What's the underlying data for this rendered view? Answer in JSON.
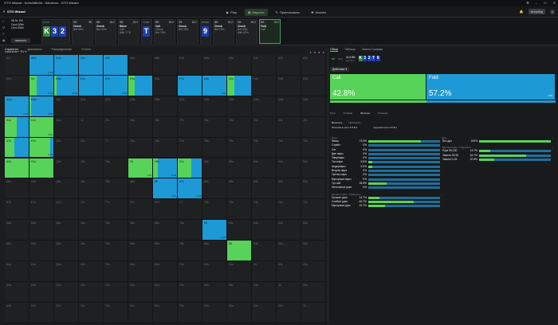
{
  "window": {
    "title": "GTO Wizard - Kc3s2d6h9d - Solutions - GTO Wizard",
    "controls": [
      "⚙",
      "–",
      "☐",
      "✕"
    ]
  },
  "app": {
    "brand": "GTO Wizard",
    "nav": [
      {
        "icon": "▶",
        "label": "Play",
        "active": false
      },
      {
        "icon": "▦",
        "label": "Изучить",
        "active": true
      },
      {
        "icon": "✎",
        "label": "Практиковать",
        "active": false
      },
      {
        "icon": "✚",
        "label": "Анализ",
        "active": false
      }
    ],
    "upgrade_label": "Апгрейд",
    "notifications_icon": "bell-icon",
    "avatar_letter": "U"
  },
  "settings": {
    "lines": [
      "5B 6c 100",
      "Cash 50bb",
      "Сеть 50bb"
    ],
    "button_label": "изменить"
  },
  "positions": [
    {
      "pos": "SB",
      "stack": "99",
      "action": "Check",
      "sub": "Bet 33%",
      "sel": false
    },
    {
      "pos": "BB",
      "stack": "16.2",
      "action": "Check",
      "sub": "Bet 30%",
      "sel": false
    },
    {
      "pos": "SB",
      "stack": "15.2",
      "action": "Raise",
      "sub": "Call",
      "extra": "Allin 77.8",
      "sel": false
    },
    {
      "pos": "BB",
      "stack": "15.2",
      "action": "Call",
      "sub": "Check",
      "extra": "Bet 75%",
      "sel": false
    },
    {
      "pos": "SB",
      "stack": "15.2",
      "action": "Check",
      "sub": "Bet 33%",
      "sel": false
    },
    {
      "pos": "BB",
      "stack": "15.2",
      "action": "Check",
      "sub": "Bet 75%",
      "sel": false
    },
    {
      "pos": "SB",
      "stack": "15.2",
      "action": "Check",
      "sub": "Bet 33%",
      "extra": "Allin 52%",
      "sel": false
    },
    {
      "pos": "BB",
      "stack": "15.2",
      "action": "Fold",
      "sub": "Call",
      "sel": true
    }
  ],
  "boards": [
    {
      "label": "FLOP",
      "stack": "3",
      "cards": [
        {
          "r": "K",
          "c": "g"
        },
        {
          "r": "3",
          "c": "b"
        },
        {
          "r": "2",
          "c": "b"
        }
      ]
    },
    {
      "label": "TURN",
      "stack": "",
      "cards": [
        {
          "r": "T",
          "c": "b"
        }
      ]
    },
    {
      "label": "RIVER",
      "stack": "",
      "cards": [
        {
          "r": "9",
          "c": "b"
        }
      ]
    }
  ],
  "grid_tabs": [
    {
      "label": "Стратегия",
      "active": true
    },
    {
      "label": "Диапазоны",
      "active": false
    },
    {
      "label": "Распределение",
      "active": false
    },
    {
      "label": "Отчеты",
      "active": false
    }
  ],
  "grid_dropdown": "стратегия + EV",
  "grid": {
    "ranks": [
      "A",
      "K",
      "Q",
      "J",
      "T",
      "9",
      "8",
      "7",
      "6",
      "5",
      "4",
      "3",
      "2"
    ],
    "strategies": {
      "AKs": [
        0.0,
        1.0,
        "-0.04"
      ],
      "AQs": [
        0.0,
        1.0,
        ""
      ],
      "AJs": [
        0.0,
        1.0,
        ""
      ],
      "ATs": [
        0.0,
        1.0,
        ""
      ],
      "KK": [
        0.3,
        0.7,
        "0.71"
      ],
      "KQs": [
        0.1,
        0.9,
        "13.23"
      ],
      "KJs": [
        0.0,
        1.0,
        ""
      ],
      "KTs": [
        0.0,
        1.0,
        "-0.03"
      ],
      "K9s": [
        0.25,
        0.75,
        ""
      ],
      "K7s": [
        0.0,
        1.0,
        ""
      ],
      "K6s": [
        0.0,
        1.0,
        "1.64"
      ],
      "K5s": [
        0.3,
        0.7,
        ""
      ],
      "AQo": [
        0.0,
        1.0,
        "0.27"
      ],
      "KQo": [
        0.05,
        0.95,
        "0.26"
      ],
      "KJo": [
        1.0,
        0.0,
        "0.01"
      ],
      "AJo": [
        0.5,
        0.5,
        ""
      ],
      "ATo": [
        0.4,
        0.6,
        ""
      ],
      "KTo": [
        0.85,
        0.15,
        "0.13"
      ],
      "A9o": [
        1.0,
        0.0,
        ""
      ],
      "K9o": [
        1.0,
        0.0,
        ""
      ],
      "99": [
        1.0,
        0.0,
        "1.01"
      ],
      "98s": [
        0.2,
        0.8,
        "-0.04"
      ],
      "97s": [
        0.55,
        0.45,
        ""
      ],
      "88": [
        0.0,
        1.0,
        "-0.11"
      ],
      "87s": [
        0.0,
        1.0,
        "-0.04"
      ],
      "66": [
        0.0,
        1.0,
        "-0.02"
      ],
      "55": [
        1.0,
        0.0,
        ""
      ]
    }
  },
  "right": {
    "tabs": [
      {
        "label": "Обзор",
        "active": true
      },
      {
        "label": "Таблица",
        "active": false
      },
      {
        "label": "Эквити Графики",
        "active": false
      }
    ],
    "summary": {
      "pos": "BB",
      "stack": "15.2",
      "nums": "41.8 BB",
      "sub": "пот:15.2",
      "cards": [
        {
          "r": "K",
          "c": "g"
        },
        {
          "r": "3",
          "c": "b"
        },
        {
          "r": "2",
          "c": "b"
        },
        {
          "r": "T",
          "c": "b"
        },
        {
          "r": "9",
          "c": "b"
        }
      ]
    },
    "action_dropdown": "Действие",
    "actions": [
      {
        "name": "Call",
        "pct": "42.8%",
        "share": 0.428,
        "color": "#57d35a",
        "ev": ""
      },
      {
        "name": "Fold",
        "pct": "57.2%",
        "share": 0.572,
        "color": "#1d9ad6",
        "ev": "4.95"
      }
    ],
    "filter_tabs": [
      {
        "label": "Руки",
        "active": false
      },
      {
        "label": "Условия",
        "active": false
      },
      {
        "label": "Фильтры",
        "active": true
      },
      {
        "label": "Блокеры",
        "active": false
      }
    ],
    "sub_tabs": [
      {
        "label": "Включить",
        "active": true
      },
      {
        "label": "Исключить",
        "active": false
      }
    ],
    "suits_left": "Флешевые карт ♠ ♥ ♣ ♦",
    "suits_right": "Одномастные ♠ ♥ ♣ ♦",
    "sec1": {
      "title": "Руки",
      "rows": [
        {
          "n": "Флеш",
          "p": "73.3%",
          "g": 0.73
        },
        {
          "n": "Стрейт",
          "p": "0%",
          "g": 0
        },
        {
          "n": "Сет",
          "p": "0%",
          "g": 0
        },
        {
          "n": "Две пары",
          "p": "0%",
          "g": 0
        },
        {
          "n": "Оверпары",
          "p": "0%",
          "g": 0
        },
        {
          "n": "Топ пара",
          "p": "5.6%",
          "g": 0.06
        },
        {
          "n": "Андерпары",
          "p": "6.5%",
          "g": 0.06
        },
        {
          "n": "Вторая пара",
          "p": "0%",
          "g": 0
        },
        {
          "n": "Третья пара",
          "p": "0%",
          "g": 0
        },
        {
          "n": "Мусорные пары",
          "p": "0%",
          "g": 0
        },
        {
          "n": "Туз хай",
          "p": "26.5%",
          "g": 0.26
        },
        {
          "n": "Ничтожные руки",
          "p": "0%",
          "g": 0
        }
      ]
    },
    "sec2": {
      "title": "EQ категории - Прямоугол",
      "rows": [
        {
          "n": "Лучшие руки",
          "p": "14.7%",
          "g": 0.15
        },
        {
          "n": "Слабые руки",
          "p": "62.7%",
          "g": 0.63
        },
        {
          "n": "Мусорные руки",
          "p": "22.7%",
          "g": 0.23
        }
      ]
    },
    "sec3": {
      "title": "Дро",
      "rows": [
        {
          "n": "Без дро",
          "p": "100%",
          "g": 1.0
        }
      ]
    },
    "sec4": {
      "title": "EQ категории - Подробно",
      "rows": [
        {
          "n": "Рука 90-100",
          "p": "14.7%",
          "g": 0.15
        },
        {
          "n": "Эквити 25-50",
          "p": "64.7%",
          "g": 0.65
        },
        {
          "n": "Эквити 0-25",
          "p": "20.6%",
          "g": 0.21
        }
      ]
    }
  },
  "colors": {
    "call": "#57d35a",
    "fold": "#1d9ad6",
    "bg": "#1b1c1e"
  }
}
